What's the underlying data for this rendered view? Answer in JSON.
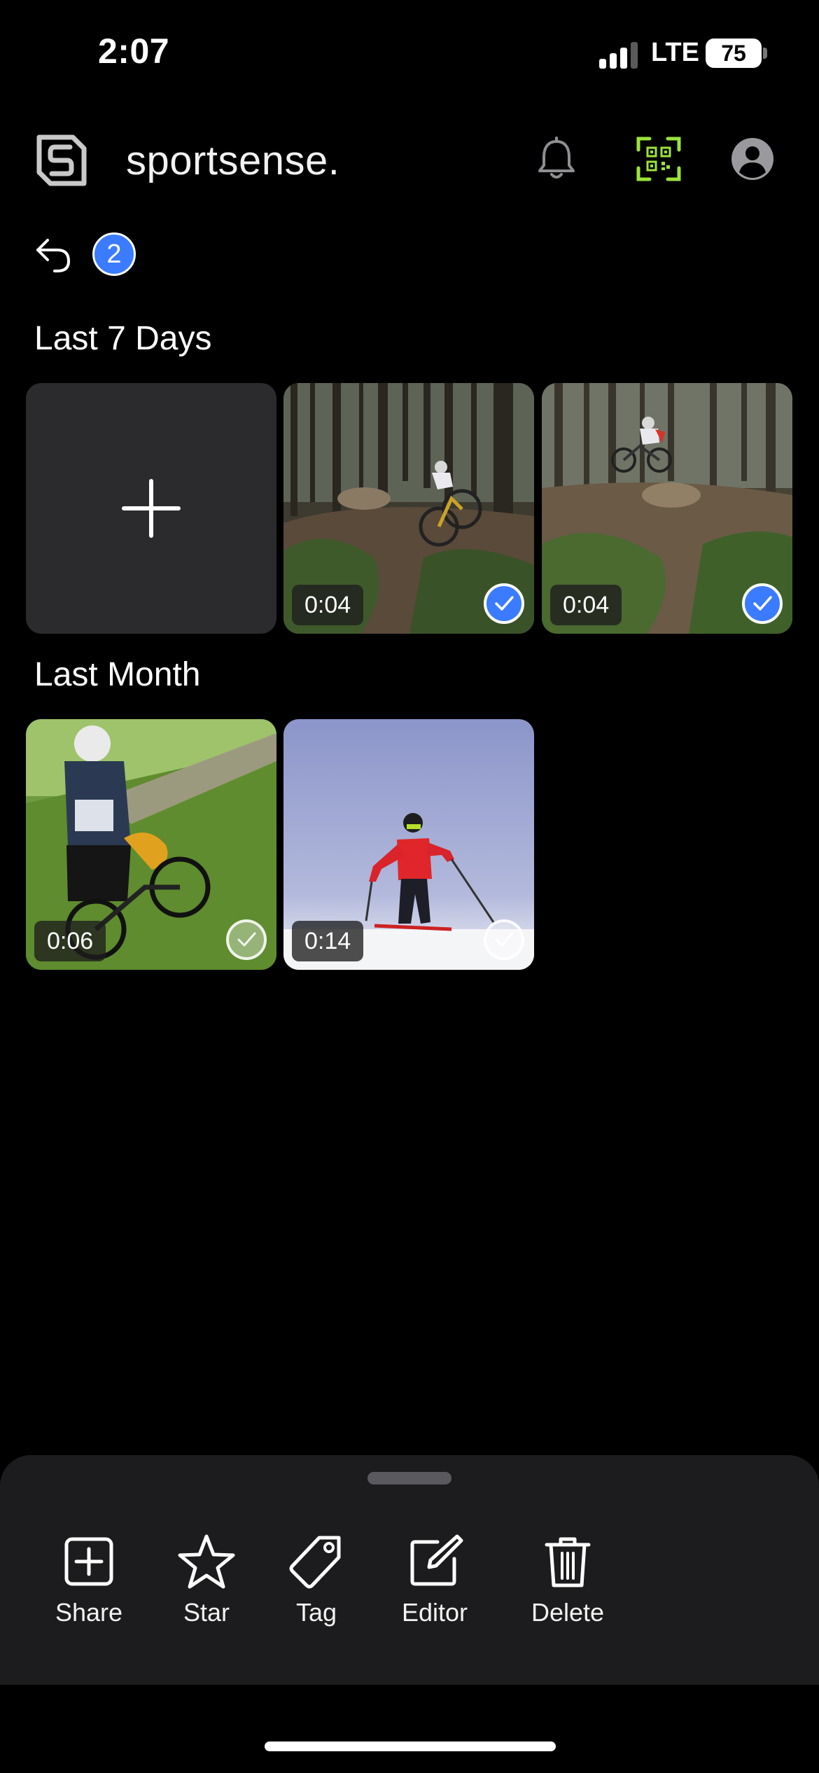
{
  "status_bar": {
    "time": "2:07",
    "network": "LTE",
    "battery": "75"
  },
  "header": {
    "brand": "sportsense.",
    "icons": [
      "logo-icon",
      "bell-icon",
      "qr-code-icon",
      "profile-icon"
    ],
    "qr_accent": "#9be33a"
  },
  "selection": {
    "count": "2",
    "badge_color": "#3b7bff"
  },
  "sections": [
    {
      "title": "Last 7 Days",
      "items": [
        {
          "type": "add",
          "icon": "plus-icon"
        },
        {
          "type": "video",
          "duration": "0:04",
          "selected": true,
          "scene": "forest mountain bike jump"
        },
        {
          "type": "video",
          "duration": "0:04",
          "selected": true,
          "scene": "forest mountain bike air"
        }
      ]
    },
    {
      "title": "Last Month",
      "items": [
        {
          "type": "video",
          "duration": "0:06",
          "selected": false,
          "scene": "mountain bike crash on grassy slope"
        },
        {
          "type": "video",
          "duration": "0:14",
          "selected": false,
          "scene": "skier in red jacket"
        }
      ]
    }
  ],
  "actions": [
    {
      "label": "Share",
      "icon": "share-add-icon"
    },
    {
      "label": "Star",
      "icon": "star-icon"
    },
    {
      "label": "Tag",
      "icon": "tag-icon"
    },
    {
      "label": "Editor",
      "icon": "edit-icon"
    },
    {
      "label": "Delete",
      "icon": "trash-icon"
    }
  ]
}
